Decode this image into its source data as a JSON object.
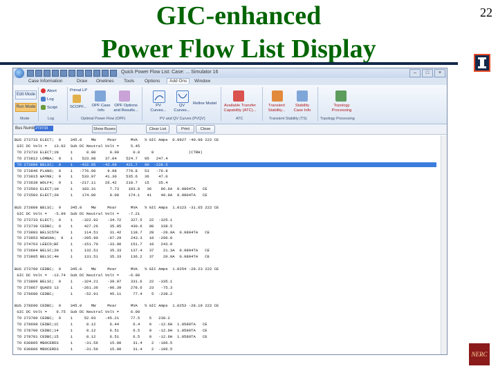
{
  "slide": {
    "title_line1": "GIC-enhanced",
    "title_line2": "Power Flow List Display",
    "page_number": "22",
    "nerc_logo_text": "NERC"
  },
  "window": {
    "title": "Quick Power Flow List: Case: ... Simulator 16",
    "buttons": [
      "–",
      "□",
      "×"
    ]
  },
  "menu": {
    "tabs": [
      "Case Information",
      "Draw",
      "Onelines",
      "Tools",
      "Options",
      "Add Ons",
      "Window"
    ],
    "active_tab": "Add Ons"
  },
  "ribbon": {
    "edit_mode": "Edit Mode",
    "run_mode": "Run Mode",
    "abort": "Abort",
    "log": "Log",
    "script": "Script",
    "primal_lp": "Primal LP",
    "scopf": "SCOPF...",
    "opf_case_info": "OPF Case Info",
    "opf_options": "OPF Options and Results...",
    "pv_curves": "PV Curves...",
    "qv_curves": "QV Curves...",
    "refine_model": "Refine Model",
    "atc": "Available Transfer Capability (ATC)...",
    "transient_stability": "Transient Stability...",
    "stability_case_info": "Stability Case Info",
    "topology_processing": "Topology Processing",
    "groups": [
      "Mode",
      "Log",
      "Optimal Power Flow (OPF)",
      "PV and QV Curves (PVQV)",
      "ATC",
      "Transient Stability (TS)",
      "Topology Processing"
    ]
  },
  "toolbar": {
    "bus_number_label": "Bus Number",
    "bus_number_value": "273733",
    "show_buses": "Show Buses",
    "clear_list": "Clear List",
    "print": "Print",
    "close": "Close"
  },
  "list_rows": [
    "BUS 273733 ELECT;  9    345.0    MW     Mvar      MVA   % GIC Amps  0.9927 -40.98 222 CE",
    " GIC DC Volt =   13.92  Sub DC Neutral Volt =     5.45",
    " TO 273733 ELECT;1N     1      0.00      0.00      0.0     0               (CTRH)",
    " TO 273812 LOMBA;  9    1    523.98    37.04    524.7   95   247.4",
    " TO 273809 BELSC;  9    1   -422.95   -42.69    421.7   90  -238.5",
    " TO 273846 PLANO;  9    1   -776.96     9.98    779.8   53   -76.8",
    " TO 273815 WAYNE;  9    1    533.97    41.30    535.6   36    47.0",
    " TO 273639 WOLF4;  9    1   -217.11    26.42    218.7   15    35.4",
    " TO 273503 ELECT;1H     1    183.31      7.73    183.8   36    96.6A  0.9804TA   CE",
    " TO 273503 ELECT;2H     1    174.00      0.00    174.1   41    40.9A  0.9804TA   CE",
    "",
    "BUS 273809 BELSC;  9    345.0    MW     Mvar      MVA   % GIC Amps  1.0123 -31.65 222 CE",
    " GIC DC Volt =   -5.99  Sub DC Neutral Volt =    -7.21",
    " TO 273733 ELECT;  9    1    -322.92    -34.72    327.5   22  -325.1",
    " TO 273730 CEDBC;  9    1     427.26     35.85    430.6   80   338.5",
    " TO 273803 BELSC5TH     1     114.51     31.42    118.7   28   -20.9A  0.9804TA   CE",
    " TO 273853 NEWSHA;  9   1    -295.90    -87.29    243.3   10  -296.8",
    " TO 274763 LEECO;BF     1    -151.70    -33.90    151.7   10   243.0",
    " TO 273604 BELSC;2H     1     132.51     35.33    137.4   37    21.3A  0.9804TA   CE",
    " TO 273805 BELSC;4H     1     131.51     35.33    136.2   37    20.9A  0.9804TA   CE",
    "",
    "BUS 273700 CEDBC;  9    345.0    MW     Mvar      MVA   % GIC Amps  1.0254 -28.23 222 CE",
    " GIC DC Volt =  -13.74  Sub DC Neutral Volt =    -6.90",
    " TO 273809 BELSC;  9    1    -324.21    -39.97    331.6   22  -335.1",
    " TO 273867 QUADS 13     1    -261.36    -96.39    278.6   23   -75.3",
    " TO 278690 CEDBC;       1     -52.91     45.11     77.4    5  -238.2",
    "",
    "BUS 278690 CEDBC;  9    345.0    MW     Mvar      MVA   % GIC Amps  1.0253 -28.19 222 CE",
    " GIC DC Volt =    9.75  Sub DC Neutral Volt =     6.00",
    " TO 273700 CEDBC;  9    1     52.93    -45.21     77.5    5   238.2",
    " TO 278699 CEDBC;1C     1      0.12      6.44      6.4    0   -12.6H  1.0580TA   CE",
    " TO 278700 CEDBC;14     1      0.12      6.51      6.5    0   -12.6H  1.0580TA   CE",
    " TO 278701 CEDBC;15     1      0.12      6.51      6.5    0   -12.6H  1.0580TA   CE",
    " TO 630805 MBOCERD3     1     -31.56     15.00     31.4    2  -106.5",
    " TO 630806 MBOCERD3     1     -31.56     15.00     31.4    2  -106.5"
  ],
  "selected_row_index": 4
}
